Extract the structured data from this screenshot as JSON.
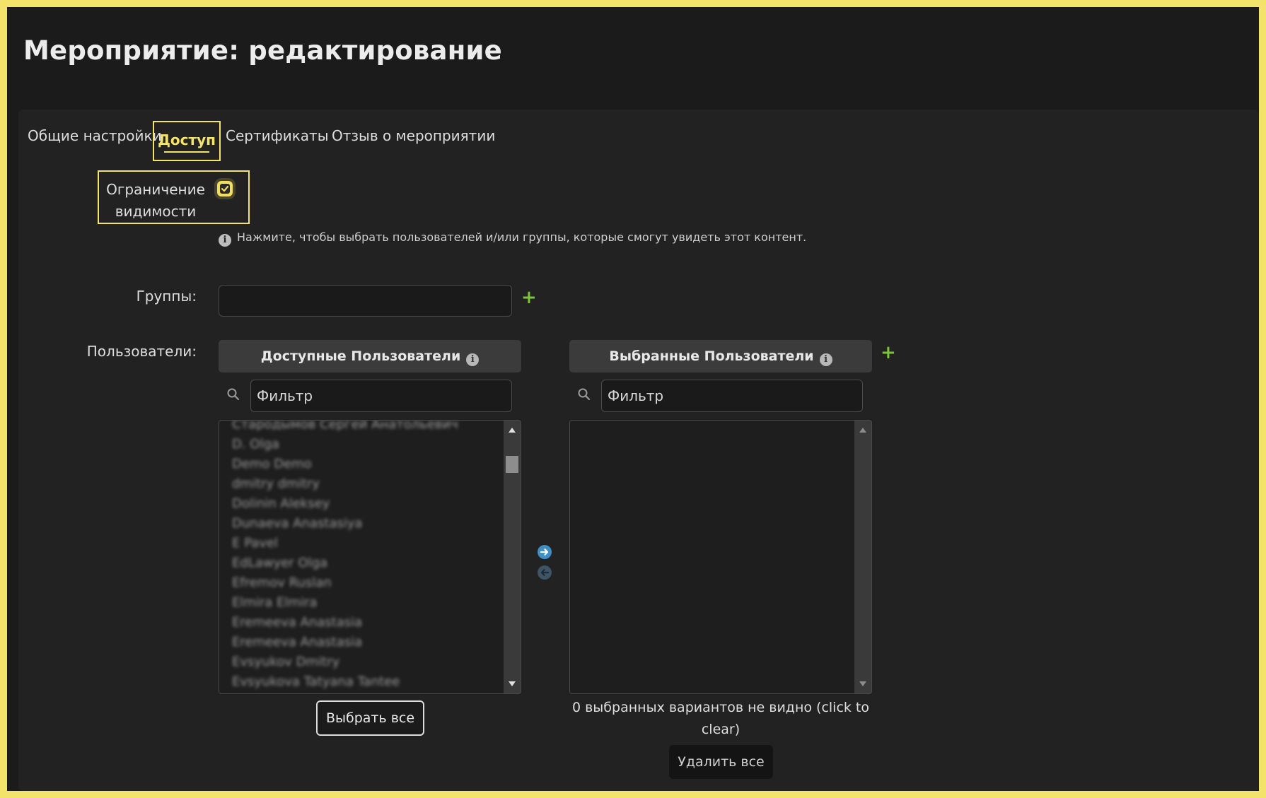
{
  "page": {
    "title": "Мероприятие: редактирование"
  },
  "tabs": [
    {
      "label": "Общие настройки",
      "active": false
    },
    {
      "label": "Доступ",
      "active": true
    },
    {
      "label": "Сертификаты",
      "active": false
    },
    {
      "label": "Отзыв о мероприятии",
      "active": false
    }
  ],
  "visibility": {
    "label": "Ограничение видимости",
    "checked": true,
    "hint": "Нажмите, чтобы выбрать пользователей и/или группы, которые смогут увидеть этот контент.",
    "hint_icon": "info-icon"
  },
  "groups": {
    "label": "Группы:",
    "value": "",
    "add_icon": "plus-icon"
  },
  "users": {
    "label": "Пользователи:",
    "available": {
      "header": "Доступные Пользователи",
      "filter_placeholder": "Фильтр",
      "items": [
        "Стародымов Сергей Анатольевич",
        "D. Olga",
        "Demo Demo",
        "dmitry dmitry",
        "Dolinin Aleksey",
        "Dunaeva Anastasiya",
        "E Pavel",
        "EdLawyer Olga",
        "Efremov Ruslan",
        "Elmira Elmira",
        "Eremeeva Anastasia",
        "Eremeeva Anastasia",
        "Evsyukov Dmitry",
        "Evsyukova Tatyana Tantee"
      ],
      "select_all_label": "Выбрать все"
    },
    "selected": {
      "header": "Выбранные Пользователи",
      "filter_placeholder": "Фильтр",
      "items": [],
      "hidden_note": "0 выбранных вариантов не видно (click to clear)",
      "remove_all_label": "Удалить все"
    }
  },
  "colors": {
    "highlight": "#f4e36a",
    "add": "#7fc23c",
    "arrow_active": "#3d8fc6",
    "arrow_inactive": "#3d5566"
  }
}
